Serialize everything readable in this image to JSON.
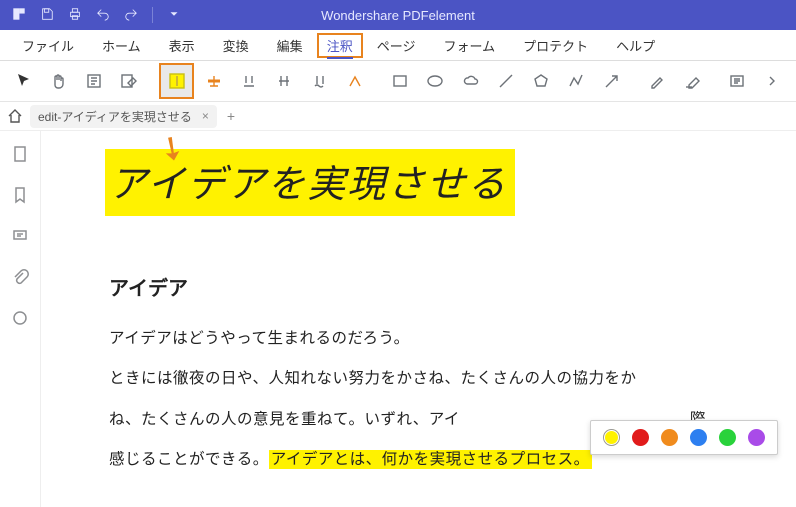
{
  "titlebar": {
    "title": "Wondershare PDFelement"
  },
  "menu": {
    "file": "ファイル",
    "home": "ホーム",
    "view": "表示",
    "convert": "変換",
    "edit": "編集",
    "annotate": "注釈",
    "page": "ページ",
    "form": "フォーム",
    "protect": "プロテクト",
    "help": "ヘルプ"
  },
  "tab": {
    "name": "edit-アイディアを実現させる",
    "close": "×",
    "add": "+"
  },
  "doc": {
    "title": "アイデアを実現させる",
    "sub": "アイデア",
    "p1": "アイデアはどうやって生まれるのだろう。",
    "p2a": "ときには徹夜の日や、人知れない努力をかさね、たくさんの人の協力をか",
    "p2b": "ね、たくさんの人の意見を重ねて。いずれ、アイ",
    "p2c": "際",
    "p3a": "感じることができる。",
    "p3hl": "アイデアとは、何かを実現させるプロセス。"
  },
  "palette": {
    "colors": [
      "#fff200",
      "#e11b1b",
      "#f08b1d",
      "#2d7ff0",
      "#29d23b",
      "#a94be8"
    ]
  }
}
